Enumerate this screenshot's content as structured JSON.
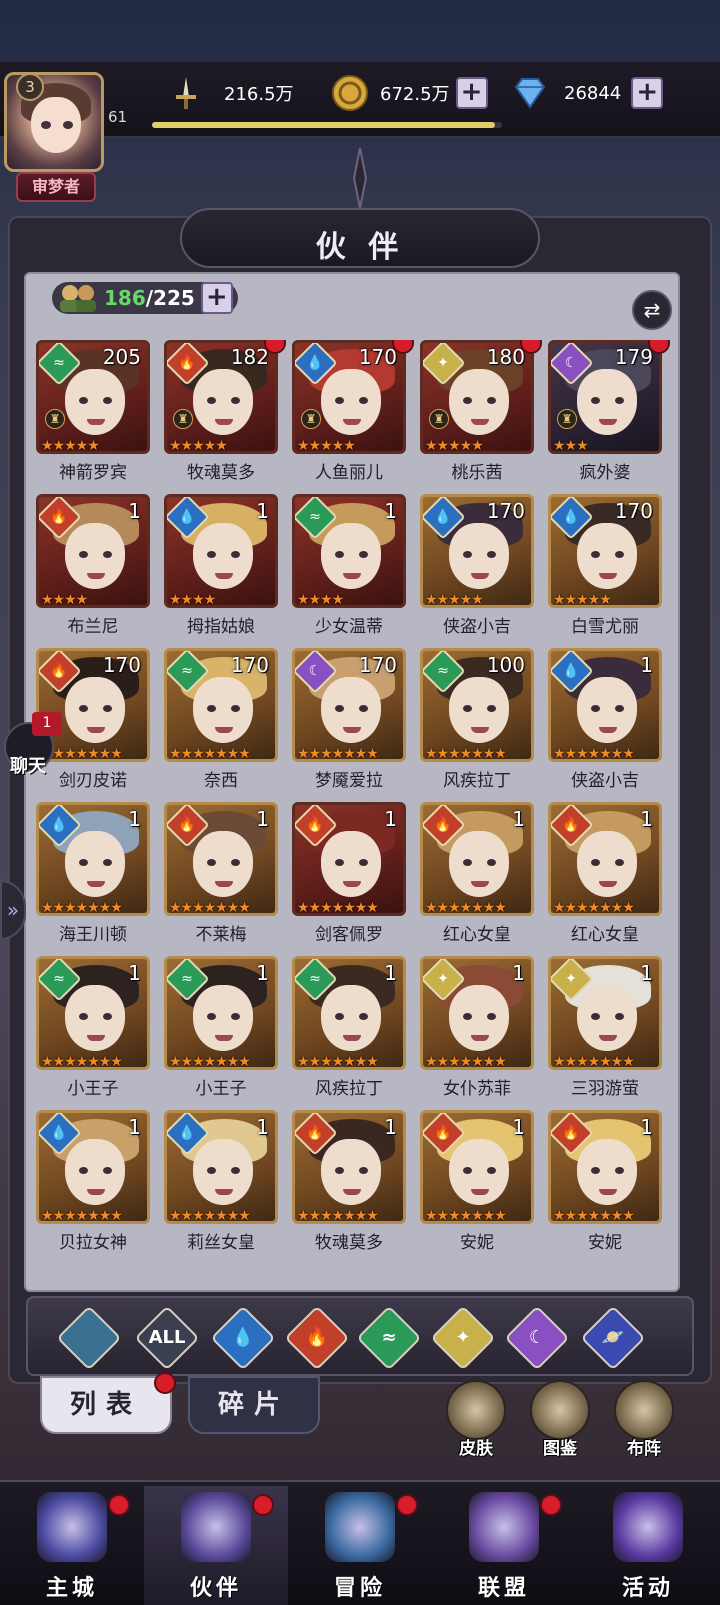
{
  "player": {
    "vip": "3",
    "level": "61",
    "title": "审梦者",
    "xp_progress": 0.98
  },
  "resources": {
    "power": "216.5万",
    "gold": "672.5万",
    "diamond": "26844"
  },
  "panel": {
    "title": "伙 伴",
    "owned": "186",
    "capacity": "/225"
  },
  "elements": {
    "water": {
      "color": "#2a6fc0",
      "glyph": "💧"
    },
    "fire": {
      "color": "#c2402a",
      "glyph": "🔥"
    },
    "wind": {
      "color": "#2b9a58",
      "glyph": "≈"
    },
    "light": {
      "color": "#c8b04a",
      "glyph": "✦"
    },
    "dark": {
      "color": "#8a4fc0",
      "glyph": "☾"
    }
  },
  "partners": [
    {
      "name": "神箭罗宾",
      "level": "205",
      "element": "wind",
      "stars": 5,
      "bg": "red",
      "hair": "#5b3324",
      "dot": false,
      "rank": true
    },
    {
      "name": "牧魂莫多",
      "level": "182",
      "element": "fire",
      "stars": 5,
      "bg": "red",
      "hair": "#3a2820",
      "dot": true,
      "rank": true
    },
    {
      "name": "人鱼丽儿",
      "level": "170",
      "element": "water",
      "stars": 5,
      "bg": "red",
      "hair": "#b23a30",
      "dot": true,
      "rank": true
    },
    {
      "name": "桃乐茜",
      "level": "180",
      "element": "light",
      "stars": 5,
      "bg": "red",
      "hair": "#6b4228",
      "dot": true,
      "rank": true
    },
    {
      "name": "疯外婆",
      "level": "179",
      "element": "dark",
      "stars": 3,
      "bg": "dark",
      "hair": "#4b4658",
      "dot": true,
      "rank": true
    },
    {
      "name": "布兰尼",
      "level": "1",
      "element": "fire",
      "stars": 4,
      "bg": "red",
      "hair": "#b58a5a",
      "dot": false,
      "rank": false
    },
    {
      "name": "拇指姑娘",
      "level": "1",
      "element": "water",
      "stars": 4,
      "bg": "red",
      "hair": "#d8b064",
      "dot": false,
      "rank": false
    },
    {
      "name": "少女温蒂",
      "level": "1",
      "element": "wind",
      "stars": 4,
      "bg": "red",
      "hair": "#c69a5a",
      "dot": false,
      "rank": false
    },
    {
      "name": "侠盗小吉",
      "level": "170",
      "element": "water",
      "stars": 5,
      "bg": "gold",
      "hair": "#3a2c3a",
      "dot": false,
      "rank": false
    },
    {
      "name": "白雪尤丽",
      "level": "170",
      "element": "water",
      "stars": 5,
      "bg": "gold",
      "hair": "#3a2a26",
      "dot": false,
      "rank": false
    },
    {
      "name": "剑刃皮诺",
      "level": "170",
      "element": "fire",
      "stars": 7,
      "bg": "gold",
      "hair": "#2b1d1a",
      "dot": false,
      "rank": false
    },
    {
      "name": "奈西",
      "level": "170",
      "element": "wind",
      "stars": 7,
      "bg": "gold",
      "hair": "#d8b46a",
      "dot": false,
      "rank": false
    },
    {
      "name": "梦魇爱拉",
      "level": "170",
      "element": "dark",
      "stars": 7,
      "bg": "gold",
      "hair": "#c8a070",
      "dot": false,
      "rank": false
    },
    {
      "name": "风疾拉丁",
      "level": "100",
      "element": "wind",
      "stars": 7,
      "bg": "gold",
      "hair": "#3a2a22",
      "dot": false,
      "rank": false
    },
    {
      "name": "侠盗小吉",
      "level": "1",
      "element": "water",
      "stars": 7,
      "bg": "gold",
      "hair": "#3a2c3a",
      "dot": false,
      "rank": false
    },
    {
      "name": "海王川顿",
      "level": "1",
      "element": "water",
      "stars": 7,
      "bg": "gold",
      "hair": "#8ea2b8",
      "dot": false,
      "rank": false
    },
    {
      "name": "不莱梅",
      "level": "1",
      "element": "fire",
      "stars": 7,
      "bg": "gold",
      "hair": "#6b4a36",
      "dot": false,
      "rank": false
    },
    {
      "name": "剑客佩罗",
      "level": "1",
      "element": "fire",
      "stars": 7,
      "bg": "red",
      "hair": "#7a2a22",
      "dot": false,
      "rank": false
    },
    {
      "name": "红心女皇",
      "level": "1",
      "element": "fire",
      "stars": 7,
      "bg": "gold",
      "hair": "#c49a60",
      "dot": false,
      "rank": false
    },
    {
      "name": "红心女皇",
      "level": "1",
      "element": "fire",
      "stars": 7,
      "bg": "gold",
      "hair": "#c49a60",
      "dot": false,
      "rank": false
    },
    {
      "name": "小王子",
      "level": "1",
      "element": "wind",
      "stars": 7,
      "bg": "gold",
      "hair": "#2e2220",
      "dot": false,
      "rank": false
    },
    {
      "name": "小王子",
      "level": "1",
      "element": "wind",
      "stars": 7,
      "bg": "gold",
      "hair": "#2e2220",
      "dot": false,
      "rank": false
    },
    {
      "name": "风疾拉丁",
      "level": "1",
      "element": "wind",
      "stars": 7,
      "bg": "gold",
      "hair": "#3a2a22",
      "dot": false,
      "rank": false
    },
    {
      "name": "女仆苏菲",
      "level": "1",
      "element": "light",
      "stars": 7,
      "bg": "gold",
      "hair": "#8a4a36",
      "dot": false,
      "rank": false
    },
    {
      "name": "三羽游萤",
      "level": "1",
      "element": "light",
      "stars": 7,
      "bg": "gold",
      "hair": "#e4e0da",
      "dot": false,
      "rank": false
    },
    {
      "name": "贝拉女神",
      "level": "1",
      "element": "water",
      "stars": 7,
      "bg": "gold",
      "hair": "#c8a06a",
      "dot": false,
      "rank": false
    },
    {
      "name": "莉丝女皇",
      "level": "1",
      "element": "water",
      "stars": 7,
      "bg": "gold",
      "hair": "#e0c890",
      "dot": false,
      "rank": false
    },
    {
      "name": "牧魂莫多",
      "level": "1",
      "element": "fire",
      "stars": 7,
      "bg": "gold",
      "hair": "#3a2820",
      "dot": false,
      "rank": false
    },
    {
      "name": "安妮",
      "level": "1",
      "element": "fire",
      "stars": 7,
      "bg": "gold",
      "hair": "#e4c470",
      "dot": false,
      "rank": false
    },
    {
      "name": "安妮",
      "level": "1",
      "element": "fire",
      "stars": 7,
      "bg": "gold",
      "hair": "#e4c470",
      "dot": false,
      "rank": false
    }
  ],
  "filters": [
    {
      "name": "filter-favorite",
      "label": "",
      "color": "#3a7090"
    },
    {
      "name": "filter-all",
      "label": "ALL",
      "color": "#3a4050"
    },
    {
      "name": "filter-water",
      "label": "💧",
      "color": "#2a6fc0"
    },
    {
      "name": "filter-fire",
      "label": "🔥",
      "color": "#c2402a"
    },
    {
      "name": "filter-wind",
      "label": "≈",
      "color": "#2b9a58"
    },
    {
      "name": "filter-light",
      "label": "✦",
      "color": "#c8b04a"
    },
    {
      "name": "filter-dark",
      "label": "☾",
      "color": "#8a4fc0"
    },
    {
      "name": "filter-cosmic",
      "label": "🪐",
      "color": "#3a4ab0"
    }
  ],
  "tabs": {
    "list": "列表",
    "fragments": "碎片"
  },
  "side_buttons": {
    "skin": "皮肤",
    "codex": "图鉴",
    "formation": "布阵"
  },
  "chat": {
    "label": "聊天",
    "badge": "1"
  },
  "nav": [
    {
      "name": "nav-main-city",
      "label": "主城"
    },
    {
      "name": "nav-partners",
      "label": "伙伴"
    },
    {
      "name": "nav-adventure",
      "label": "冒险"
    },
    {
      "name": "nav-alliance",
      "label": "联盟"
    },
    {
      "name": "nav-events",
      "label": "活动"
    }
  ]
}
